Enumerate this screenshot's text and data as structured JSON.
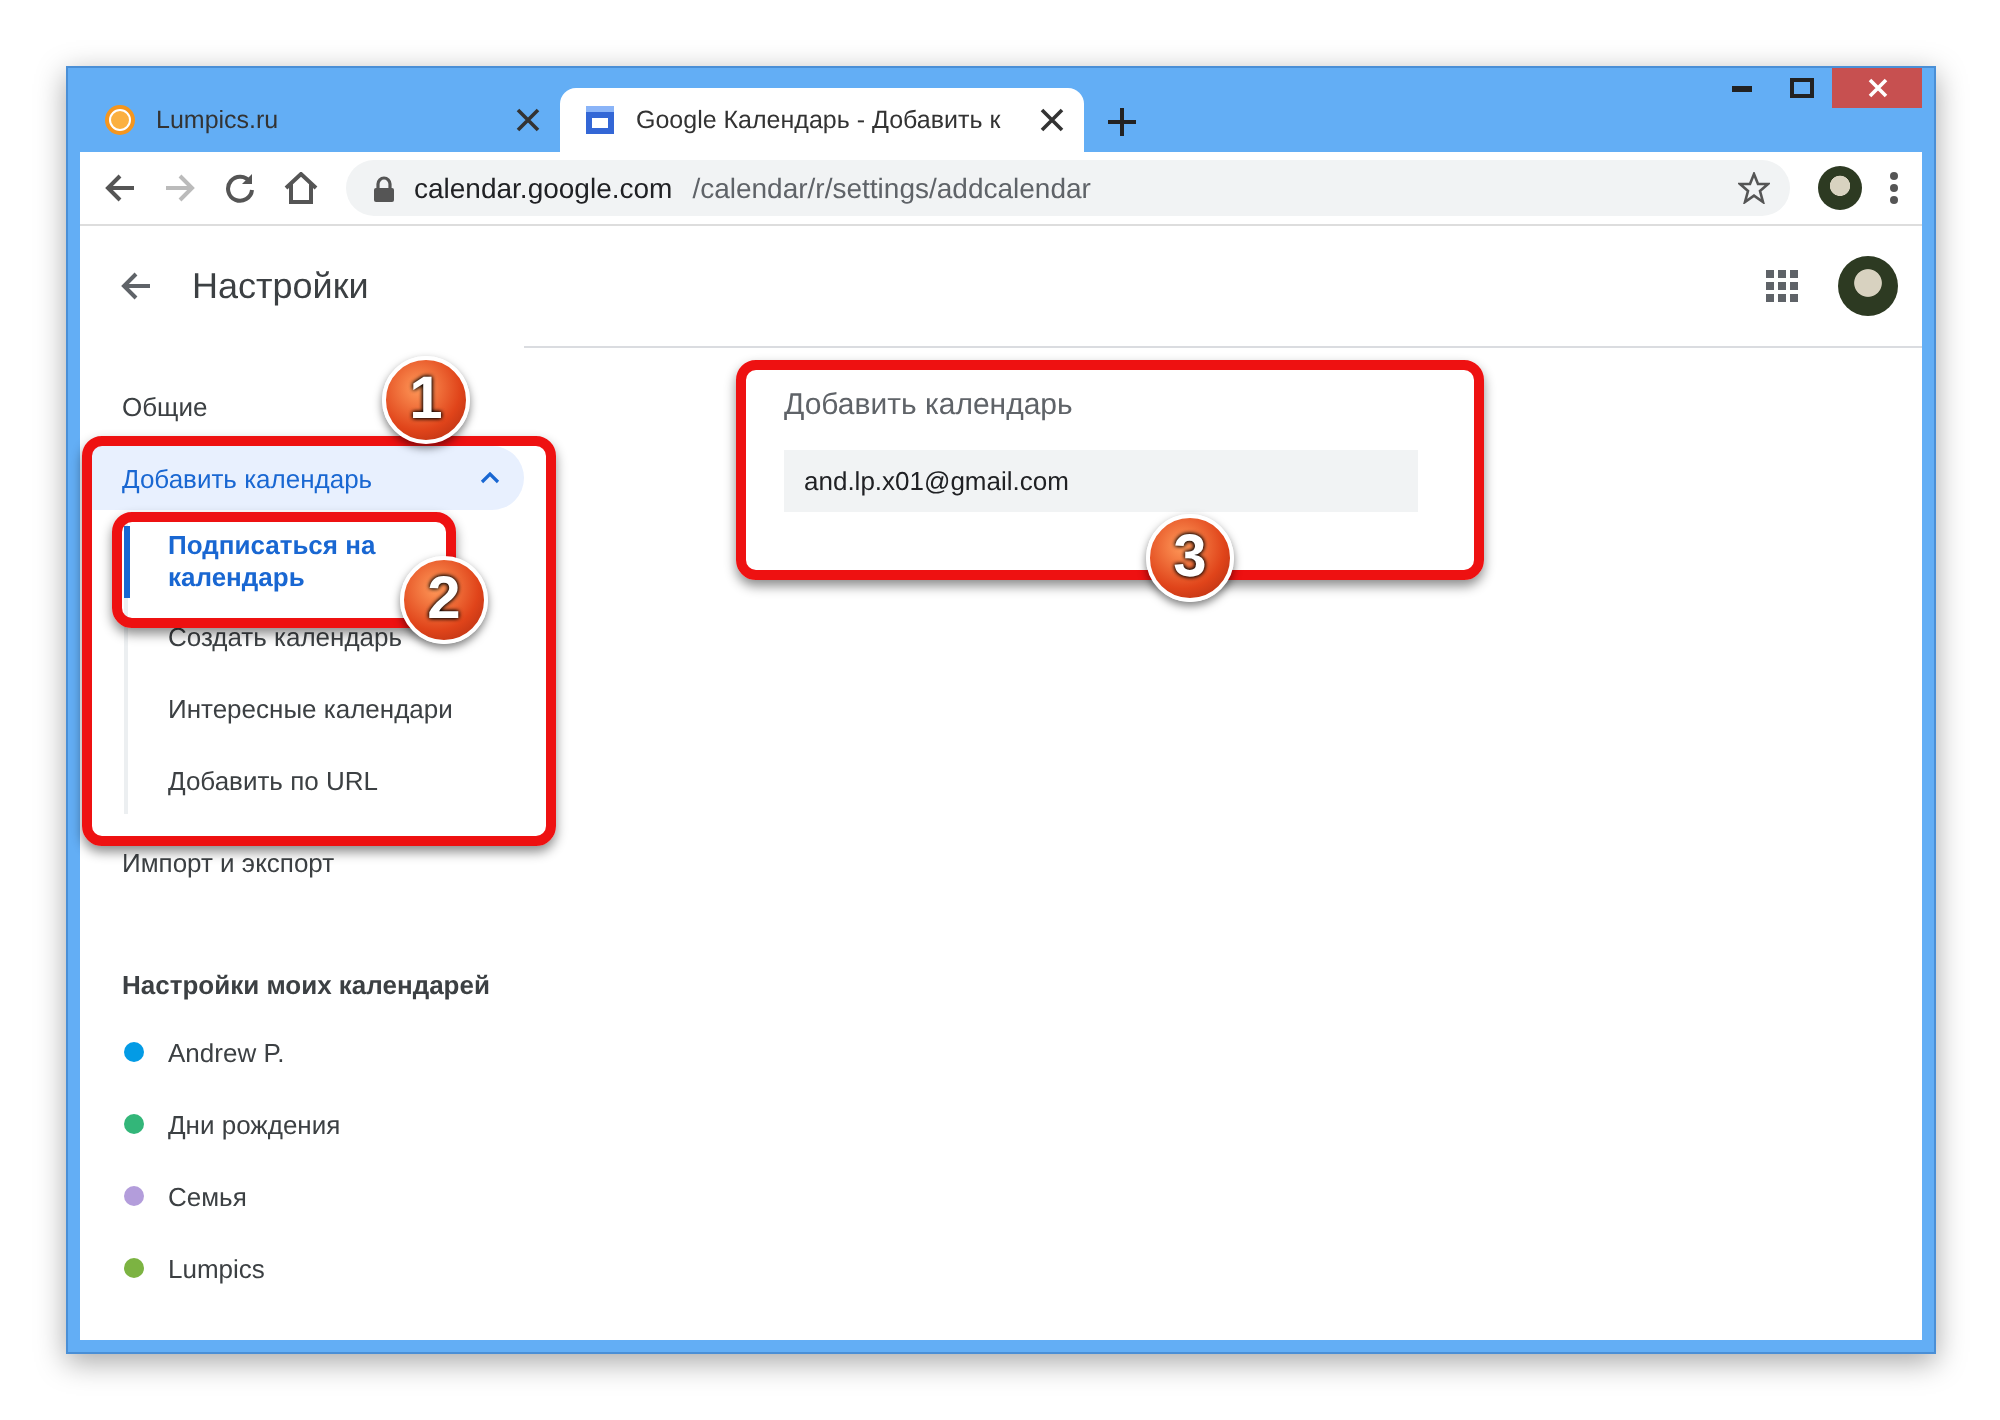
{
  "browser": {
    "tabs": [
      {
        "title": "Lumpics.ru",
        "selected": false
      },
      {
        "title": "Google Календарь - Добавить к",
        "selected": true
      }
    ],
    "url": {
      "host": "calendar.google.com",
      "path": "/calendar/r/settings/addcalendar"
    }
  },
  "header": {
    "title": "Настройки"
  },
  "sidebar": {
    "items": [
      {
        "label": "Общие",
        "expanded": false
      },
      {
        "label": "Добавить календарь",
        "expanded": true,
        "children": [
          {
            "label": "Подписаться на календарь",
            "selected": true
          },
          {
            "label": "Создать календарь",
            "selected": false
          },
          {
            "label": "Интересные календари",
            "selected": false
          },
          {
            "label": "Добавить по URL",
            "selected": false
          }
        ]
      },
      {
        "label": "Импорт и экспорт",
        "expanded": false
      }
    ],
    "my_calendars": {
      "title": "Настройки моих календарей",
      "items": [
        {
          "label": "Andrew P.",
          "color": "#039be5"
        },
        {
          "label": "Дни рождения",
          "color": "#33b679"
        },
        {
          "label": "Семья",
          "color": "#b39ddb"
        },
        {
          "label": "Lumpics",
          "color": "#7cb342"
        }
      ]
    }
  },
  "main": {
    "title": "Добавить календарь",
    "input": {
      "value": "and.lp.x01@gmail.com"
    }
  },
  "annotations": [
    {
      "number": "1"
    },
    {
      "number": "2"
    },
    {
      "number": "3"
    }
  ]
}
